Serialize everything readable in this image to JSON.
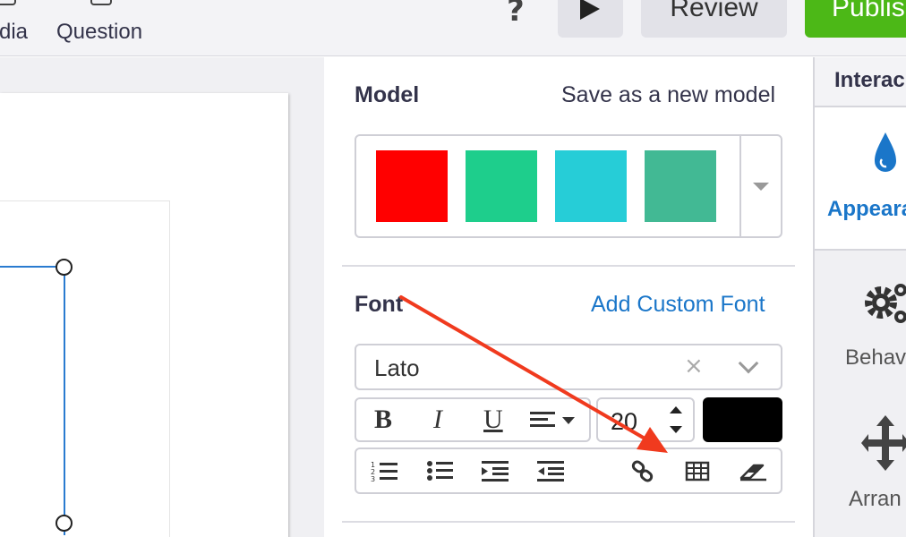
{
  "topbar": {
    "media_label": "dia",
    "question_label": "Question",
    "help_glyph": "?",
    "play_icon": "play-icon",
    "review_label": "Review",
    "publish_label": "Publis"
  },
  "panel": {
    "model": {
      "title": "Model",
      "save_link": "Save as a new model",
      "swatches": [
        "#ff0000",
        "#1ece8c",
        "#26cdd7",
        "#42b994"
      ]
    },
    "font": {
      "title": "Font",
      "add_link": "Add Custom Font",
      "family": "Lato",
      "clear_glyph": "×",
      "bold": "B",
      "italic": "I",
      "underline": "U",
      "size": "20",
      "color": "#000000"
    }
  },
  "right_tabs": {
    "header": "Interac",
    "appearance": "Appeara",
    "behavior": "Behav",
    "arrange": "Arran"
  },
  "colors": {
    "accent_blue": "#1a76c9",
    "publish_green": "#4cb817",
    "annotation_red": "#f03a1e"
  }
}
